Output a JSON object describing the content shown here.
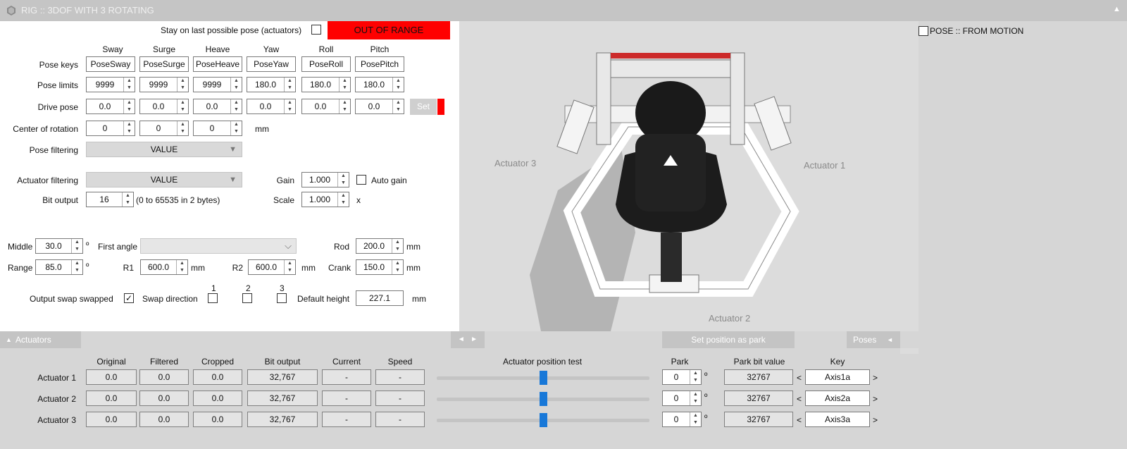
{
  "window": {
    "title": "RIG :: 3DOF WITH 3 ROTATING"
  },
  "top": {
    "stay_label": "Stay on last possible pose (actuators)",
    "stay_checked": "",
    "out_of_range": "OUT OF RANGE"
  },
  "axes": [
    "Sway",
    "Surge",
    "Heave",
    "Yaw",
    "Roll",
    "Pitch"
  ],
  "pose_keys": {
    "label": "Pose keys",
    "values": [
      "PoseSway",
      "PoseSurge",
      "PoseHeave",
      "PoseYaw",
      "PoseRoll",
      "PosePitch"
    ]
  },
  "pose_limits": {
    "label": "Pose limits",
    "values": [
      "9999",
      "9999",
      "9999",
      "180.0",
      "180.0",
      "180.0"
    ]
  },
  "drive_pose": {
    "label": "Drive pose",
    "values": [
      "0.0",
      "0.0",
      "0.0",
      "0.0",
      "0.0",
      "0.0"
    ],
    "set_label": "Set"
  },
  "center_rotation": {
    "label": "Center of rotation",
    "values": [
      "0",
      "0",
      "0"
    ],
    "unit": "mm"
  },
  "pose_filtering": {
    "label": "Pose filtering",
    "value": "VALUE"
  },
  "actuator_filtering": {
    "label": "Actuator filtering",
    "value": "VALUE"
  },
  "gain": {
    "label": "Gain",
    "value": "1.000",
    "auto_label": "Auto gain"
  },
  "bit_output": {
    "label": "Bit output",
    "value": "16",
    "hint": "(0 to 65535 in 2 bytes)"
  },
  "scale": {
    "label": "Scale",
    "value": "1.000",
    "unit": "x"
  },
  "geometry": {
    "middle_label": "Middle",
    "middle": "30.0",
    "range_label": "Range",
    "range": "85.0",
    "deg": "º",
    "first_angle_label": "First angle",
    "first_angle": "",
    "rod_label": "Rod",
    "rod": "200.0",
    "crank_label": "Crank",
    "crank": "150.0",
    "r1_label": "R1",
    "r1": "600.0",
    "r2_label": "R2",
    "r2": "600.0",
    "mm": "mm"
  },
  "swap": {
    "output_label": "Output swap swapped",
    "output_checked": "✓",
    "direction_label": "Swap direction",
    "nums": [
      "1",
      "2",
      "3"
    ],
    "default_height_label": "Default height",
    "default_height": "227.1",
    "unit": "mm"
  },
  "viewport": {
    "labels": [
      "Actuator 3",
      "Actuator 1",
      "Actuator 2"
    ]
  },
  "tabs": {
    "actuators": "Actuators",
    "set_park": "Set position as park",
    "poses": "Poses",
    "nav_left": "◄",
    "nav_right": "►",
    "up": "▲"
  },
  "table": {
    "headers": [
      "Original",
      "Filtered",
      "Cropped",
      "Bit output",
      "Current",
      "Speed"
    ],
    "test_header": "Actuator position test",
    "park_header": "Park",
    "park_bit_header": "Park bit value",
    "key_header": "Key",
    "rows": [
      {
        "name": "Actuator 1",
        "values": [
          "0.0",
          "0.0",
          "0.0",
          "32,767",
          "-",
          "-"
        ],
        "slider": 0.5,
        "park": "0",
        "park_bit": "32767",
        "key": "Axis1a"
      },
      {
        "name": "Actuator 2",
        "values": [
          "0.0",
          "0.0",
          "0.0",
          "32,767",
          "-",
          "-"
        ],
        "slider": 0.5,
        "park": "0",
        "park_bit": "32767",
        "key": "Axis2a"
      },
      {
        "name": "Actuator 3",
        "values": [
          "0.0",
          "0.0",
          "0.0",
          "32,767",
          "-",
          "-"
        ],
        "slider": 0.5,
        "park": "0",
        "park_bit": "32767",
        "key": "Axis3a"
      }
    ],
    "key_prev": "<",
    "key_next": ">"
  },
  "right": {
    "pose_from_motion": "POSE :: FROM MOTION"
  },
  "colors": {
    "accent": "#1878d8",
    "alert": "#ff0000"
  },
  "icons": {
    "window": "hexagon-icon",
    "collapse": "caret-up-icon"
  }
}
